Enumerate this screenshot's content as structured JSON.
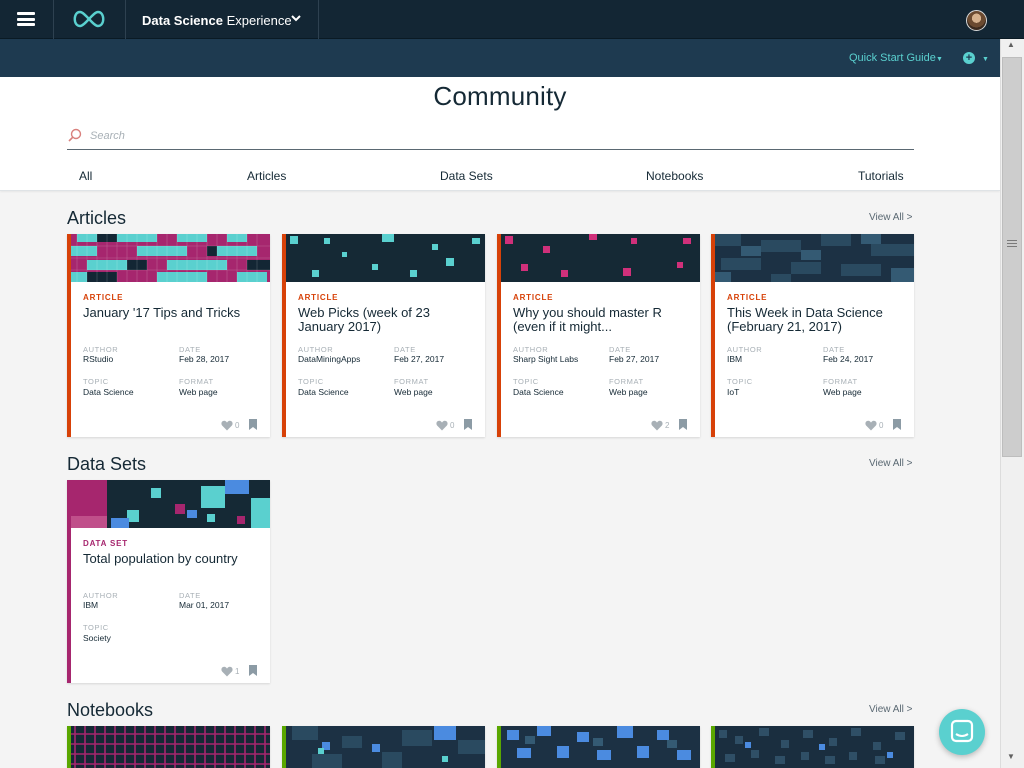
{
  "topbar": {
    "product_bold": "Data Science",
    "product_light": "Experience"
  },
  "subbar": {
    "quick_start": "Quick Start Guide"
  },
  "hero": {
    "title": "Community",
    "search_placeholder": "Search",
    "filters": [
      "All",
      "Articles",
      "Data Sets",
      "Notebooks",
      "Tutorials"
    ]
  },
  "sections": {
    "articles": {
      "title": "Articles",
      "view_all": "View All >"
    },
    "datasets": {
      "title": "Data Sets",
      "view_all": "View All >"
    },
    "notebooks": {
      "title": "Notebooks",
      "view_all": "View All >"
    }
  },
  "labels": {
    "author": "AUTHOR",
    "date": "DATE",
    "topic": "TOPIC",
    "format": "FORMAT"
  },
  "articles": [
    {
      "type": "ARTICLE",
      "title": "January '17 Tips and Tricks",
      "author": "RStudio",
      "date": "Feb 28, 2017",
      "topic": "Data Science",
      "format": "Web page",
      "likes": "0"
    },
    {
      "type": "ARTICLE",
      "title": "Web Picks (week of 23 January 2017)",
      "author": "DataMiningApps",
      "date": "Feb 27, 2017",
      "topic": "Data Science",
      "format": "Web page",
      "likes": "0"
    },
    {
      "type": "ARTICLE",
      "title": "Why you should master R (even if it might...",
      "author": "Sharp Sight Labs",
      "date": "Feb 27, 2017",
      "topic": "Data Science",
      "format": "Web page",
      "likes": "2"
    },
    {
      "type": "ARTICLE",
      "title": "This Week in Data Science (February 21, 2017)",
      "author": "IBM",
      "date": "Feb 24, 2017",
      "topic": "IoT",
      "format": "Web page",
      "likes": "0"
    }
  ],
  "datasets": [
    {
      "type": "DATA SET",
      "title": "Total population by country",
      "author": "IBM",
      "date": "Mar 01, 2017",
      "topic": "Society",
      "likes": "1"
    }
  ],
  "colors": {
    "topbar": "#132634",
    "subbar": "#1e3a50",
    "accent_teal": "#5ad0cf",
    "article_orange": "#d74108",
    "dataset_magenta": "#a6266e",
    "notebook_green": "#5aa700"
  },
  "icons": [
    "hamburger-icon",
    "infinity-logo-icon",
    "chevron-down-icon",
    "avatar",
    "plus-circle-icon",
    "search-icon",
    "heart-icon",
    "bookmark-icon",
    "chat-icon"
  ]
}
